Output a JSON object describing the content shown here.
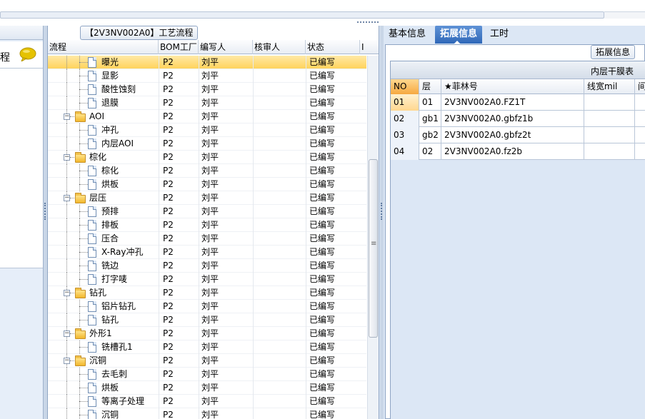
{
  "left_panel": {
    "label": "程"
  },
  "middle_panel": {
    "title": "【2V3NV002A0】工艺流程",
    "columns": [
      "流程",
      "BOM工厂",
      "编写人",
      "核审人",
      "状态",
      "I"
    ],
    "rows": [
      {
        "name": "曝光",
        "type": "doc",
        "level": 2,
        "bom": "P2",
        "writer": "刘平",
        "reviewer": "",
        "status": "已编写",
        "selected": true
      },
      {
        "name": "显影",
        "type": "doc",
        "level": 2,
        "bom": "P2",
        "writer": "刘平",
        "reviewer": "",
        "status": "已编写"
      },
      {
        "name": "酸性蚀刻",
        "type": "doc",
        "level": 2,
        "bom": "P2",
        "writer": "刘平",
        "reviewer": "",
        "status": "已编写"
      },
      {
        "name": "退膜",
        "type": "doc",
        "level": 2,
        "bom": "P2",
        "writer": "刘平",
        "reviewer": "",
        "status": "已编写"
      },
      {
        "name": "AOI",
        "type": "folder",
        "level": 1,
        "bom": "P2",
        "writer": "刘平",
        "reviewer": "",
        "status": "已编写"
      },
      {
        "name": "冲孔",
        "type": "doc",
        "level": 2,
        "bom": "P2",
        "writer": "刘平",
        "reviewer": "",
        "status": "已编写"
      },
      {
        "name": "内层AOI",
        "type": "doc",
        "level": 2,
        "bom": "P2",
        "writer": "刘平",
        "reviewer": "",
        "status": "已编写"
      },
      {
        "name": "棕化",
        "type": "folder",
        "level": 1,
        "bom": "P2",
        "writer": "刘平",
        "reviewer": "",
        "status": "已编写"
      },
      {
        "name": "棕化",
        "type": "doc",
        "level": 2,
        "bom": "P2",
        "writer": "刘平",
        "reviewer": "",
        "status": "已编写"
      },
      {
        "name": "烘板",
        "type": "doc",
        "level": 2,
        "bom": "P2",
        "writer": "刘平",
        "reviewer": "",
        "status": "已编写"
      },
      {
        "name": "层压",
        "type": "folder",
        "level": 1,
        "bom": "P2",
        "writer": "刘平",
        "reviewer": "",
        "status": "已编写"
      },
      {
        "name": "预排",
        "type": "doc",
        "level": 2,
        "bom": "P2",
        "writer": "刘平",
        "reviewer": "",
        "status": "已编写"
      },
      {
        "name": "排板",
        "type": "doc",
        "level": 2,
        "bom": "P2",
        "writer": "刘平",
        "reviewer": "",
        "status": "已编写"
      },
      {
        "name": "压合",
        "type": "doc",
        "level": 2,
        "bom": "P2",
        "writer": "刘平",
        "reviewer": "",
        "status": "已编写"
      },
      {
        "name": "X-Ray冲孔",
        "type": "doc",
        "level": 2,
        "bom": "P2",
        "writer": "刘平",
        "reviewer": "",
        "status": "已编写"
      },
      {
        "name": "铣边",
        "type": "doc",
        "level": 2,
        "bom": "P2",
        "writer": "刘平",
        "reviewer": "",
        "status": "已编写"
      },
      {
        "name": "打字唛",
        "type": "doc",
        "level": 2,
        "bom": "P2",
        "writer": "刘平",
        "reviewer": "",
        "status": "已编写"
      },
      {
        "name": "钻孔",
        "type": "folder",
        "level": 1,
        "bom": "P2",
        "writer": "刘平",
        "reviewer": "",
        "status": "已编写"
      },
      {
        "name": "铝片钻孔",
        "type": "doc",
        "level": 2,
        "bom": "P2",
        "writer": "刘平",
        "reviewer": "",
        "status": "已编写"
      },
      {
        "name": "钻孔",
        "type": "doc",
        "level": 2,
        "bom": "P2",
        "writer": "刘平",
        "reviewer": "",
        "status": "已编写"
      },
      {
        "name": "外形1",
        "type": "folder",
        "level": 1,
        "bom": "P2",
        "writer": "刘平",
        "reviewer": "",
        "status": "已编写"
      },
      {
        "name": "铣槽孔1",
        "type": "doc",
        "level": 2,
        "bom": "P2",
        "writer": "刘平",
        "reviewer": "",
        "status": "已编写"
      },
      {
        "name": "沉铜",
        "type": "folder",
        "level": 1,
        "bom": "P2",
        "writer": "刘平",
        "reviewer": "",
        "status": "已编写"
      },
      {
        "name": "去毛刺",
        "type": "doc",
        "level": 2,
        "bom": "P2",
        "writer": "刘平",
        "reviewer": "",
        "status": "已编写"
      },
      {
        "name": "烘板",
        "type": "doc",
        "level": 2,
        "bom": "P2",
        "writer": "刘平",
        "reviewer": "",
        "status": "已编写"
      },
      {
        "name": "等离子处理",
        "type": "doc",
        "level": 2,
        "bom": "P2",
        "writer": "刘平",
        "reviewer": "",
        "status": "已编写"
      },
      {
        "name": "沉铜",
        "type": "doc",
        "level": 2,
        "bom": "P2",
        "writer": "刘平",
        "reviewer": "",
        "status": "已编写"
      }
    ]
  },
  "right_panel": {
    "tabs": [
      {
        "label": "基本信息",
        "active": false
      },
      {
        "label": "拓展信息",
        "active": true
      },
      {
        "label": "工时",
        "active": false
      }
    ],
    "subtab": "拓展信息",
    "table_caption": "内层干膜表",
    "columns": [
      "NO",
      "层",
      "★菲林号",
      "线宽mil",
      "间"
    ],
    "rows": [
      {
        "no": "01",
        "layer": "01",
        "film": "2V3NV002A0.FZ1T",
        "width": "",
        "gap": ""
      },
      {
        "no": "02",
        "layer": "gb1",
        "film": "2V3NV002A0.gbfz1b",
        "width": "",
        "gap": ""
      },
      {
        "no": "03",
        "layer": "gb2",
        "film": "2V3NV002A0.gbfz2t",
        "width": "",
        "gap": ""
      },
      {
        "no": "04",
        "layer": "02",
        "film": "2V3NV002A0.fz2b",
        "width": "",
        "gap": ""
      }
    ]
  },
  "colors": {
    "selected_row": "#ffd35c",
    "active_tab": "#2f68b8",
    "chat_icon": "#e5c200"
  }
}
